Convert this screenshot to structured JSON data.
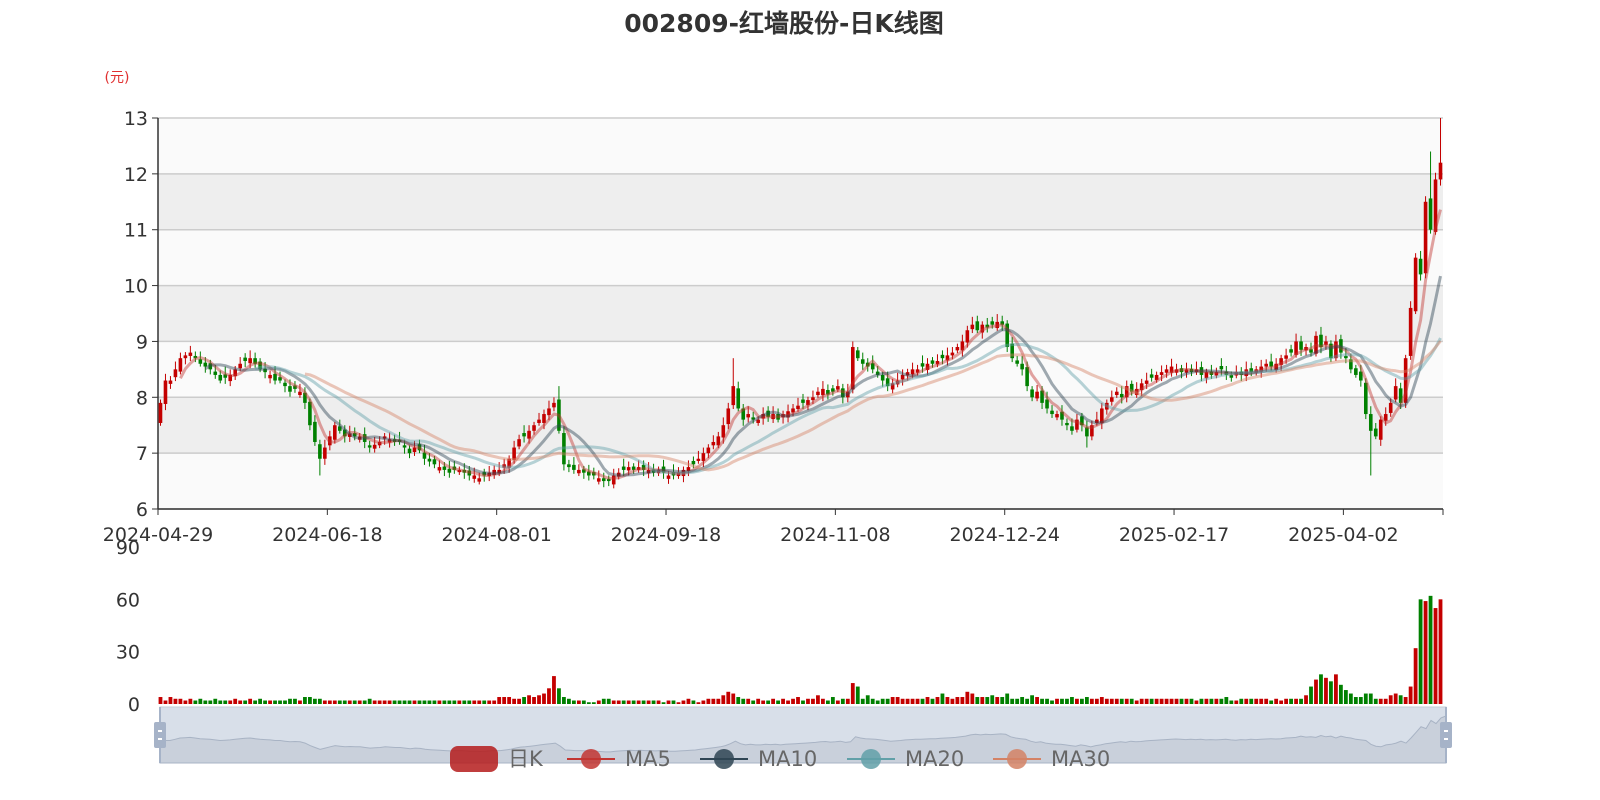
{
  "chart_data": {
    "type": "candlestick",
    "title": "002809-红墙股份-日K线图",
    "y_unit_label": "(元)",
    "ylim": [
      6,
      13
    ],
    "y_ticks": [
      6,
      7,
      8,
      9,
      10,
      11,
      12,
      13
    ],
    "volume_ylim": [
      0,
      90
    ],
    "volume_ticks": [
      0,
      30,
      60,
      90
    ],
    "x_tick_every": 34,
    "x_tick_labels": [
      "2024-04-29",
      "2024-06-18",
      "2024-08-01",
      "2024-09-18",
      "2024-11-08",
      "2024-12-24",
      "2025-02-17",
      "2025-04-02"
    ],
    "legend": [
      "日K",
      "MA5",
      "MA10",
      "MA20",
      "MA30"
    ],
    "legend_placement": "bottom-center",
    "colors": {
      "up": "#c40000",
      "down": "#008000",
      "MA5": "#c23531",
      "MA10": "#2f4554",
      "MA20": "#61a0a8",
      "MA30": "#d48265"
    },
    "close": [
      7.9,
      8.3,
      8.3,
      8.5,
      8.7,
      8.75,
      8.8,
      8.7,
      8.6,
      8.55,
      8.5,
      8.4,
      8.3,
      8.35,
      8.4,
      8.5,
      8.6,
      8.65,
      8.7,
      8.6,
      8.5,
      8.45,
      8.4,
      8.3,
      8.3,
      8.2,
      8.1,
      8.15,
      8.1,
      7.9,
      7.5,
      7.2,
      6.9,
      7.1,
      7.3,
      7.5,
      7.4,
      7.3,
      7.35,
      7.3,
      7.3,
      7.2,
      7.1,
      7.15,
      7.2,
      7.3,
      7.25,
      7.2,
      7.2,
      7.1,
      7.0,
      7.1,
      7.05,
      6.9,
      6.85,
      6.8,
      6.75,
      6.7,
      6.65,
      6.7,
      6.7,
      6.65,
      6.6,
      6.6,
      6.55,
      6.6,
      6.65,
      6.7,
      6.7,
      6.8,
      6.9,
      7.1,
      7.25,
      7.3,
      7.4,
      7.5,
      7.6,
      7.7,
      7.8,
      7.9,
      7.4,
      6.8,
      6.75,
      6.7,
      6.7,
      6.65,
      6.6,
      6.6,
      6.55,
      6.5,
      6.5,
      6.6,
      6.65,
      6.7,
      6.75,
      6.7,
      6.75,
      6.7,
      6.7,
      6.65,
      6.7,
      6.65,
      6.6,
      6.6,
      6.65,
      6.7,
      6.75,
      6.8,
      6.9,
      7.0,
      7.1,
      7.2,
      7.3,
      7.5,
      7.8,
      8.2,
      7.8,
      7.6,
      7.7,
      7.6,
      7.6,
      7.7,
      7.65,
      7.7,
      7.6,
      7.7,
      7.75,
      7.8,
      7.85,
      7.9,
      7.95,
      8.0,
      8.1,
      8.15,
      8.05,
      8.1,
      8.2,
      8.0,
      8.1,
      8.9,
      8.7,
      8.6,
      8.55,
      8.5,
      8.4,
      8.3,
      8.2,
      8.25,
      8.3,
      8.4,
      8.45,
      8.5,
      8.5,
      8.55,
      8.6,
      8.6,
      8.65,
      8.7,
      8.75,
      8.8,
      8.9,
      9.0,
      9.2,
      9.3,
      9.2,
      9.3,
      9.25,
      9.3,
      9.35,
      9.3,
      8.9,
      8.7,
      8.6,
      8.5,
      8.2,
      8.0,
      8.1,
      7.9,
      7.8,
      7.7,
      7.7,
      7.6,
      7.5,
      7.4,
      7.6,
      7.5,
      7.3,
      7.5,
      7.6,
      7.8,
      7.9,
      8.0,
      8.1,
      8.0,
      8.2,
      8.1,
      8.15,
      8.25,
      8.3,
      8.35,
      8.4,
      8.45,
      8.5,
      8.55,
      8.5,
      8.45,
      8.5,
      8.45,
      8.5,
      8.4,
      8.45,
      8.4,
      8.45,
      8.5,
      8.4,
      8.35,
      8.45,
      8.4,
      8.5,
      8.45,
      8.5,
      8.55,
      8.6,
      8.55,
      8.6,
      8.7,
      8.75,
      8.8,
      9.0,
      8.85,
      8.9,
      8.8,
      9.1,
      8.9,
      9.0,
      8.7,
      9.0,
      8.8,
      8.7,
      8.5,
      8.4,
      8.3,
      7.7,
      7.4,
      7.3,
      7.6,
      7.7,
      7.9,
      8.2,
      7.9,
      8.7,
      9.6,
      10.5,
      10.2,
      11.5,
      11.0,
      11.9,
      12.2
    ],
    "extremes": {
      "32": {
        "low": 6.6
      },
      "80": {
        "high": 8.2
      },
      "115": {
        "high": 8.7
      },
      "139": {
        "high": 9.0
      },
      "186": {
        "low": 7.1
      },
      "243": {
        "low": 6.6
      },
      "255": {
        "high": 12.4
      },
      "257": {
        "high": 13.0
      }
    },
    "volume": [
      4,
      2,
      4,
      3,
      3,
      2,
      3,
      2,
      3,
      2,
      2,
      3,
      2,
      2,
      2,
      3,
      2,
      2,
      3,
      2,
      3,
      2,
      2,
      2,
      2,
      2,
      3,
      3,
      2,
      4,
      4,
      3,
      3,
      2,
      2,
      2,
      2,
      2,
      2,
      2,
      2,
      2,
      3,
      2,
      2,
      2,
      2,
      2,
      2,
      2,
      2,
      2,
      2,
      2,
      2,
      2,
      2,
      2,
      2,
      2,
      2,
      2,
      2,
      2,
      2,
      2,
      2,
      2,
      4,
      4,
      4,
      3,
      3,
      4,
      5,
      4,
      5,
      6,
      9,
      16,
      9,
      4,
      3,
      2,
      2,
      2,
      1,
      1,
      2,
      3,
      3,
      2,
      2,
      2,
      2,
      2,
      2,
      2,
      2,
      2,
      2,
      1,
      2,
      2,
      1,
      2,
      3,
      2,
      1,
      2,
      3,
      3,
      3,
      5,
      7,
      6,
      4,
      3,
      3,
      2,
      3,
      2,
      2,
      3,
      2,
      3,
      2,
      3,
      4,
      2,
      3,
      3,
      5,
      3,
      2,
      4,
      2,
      3,
      3,
      12,
      10,
      3,
      5,
      3,
      2,
      3,
      3,
      4,
      4,
      3,
      3,
      3,
      3,
      3,
      4,
      3,
      4,
      6,
      4,
      3,
      4,
      4,
      7,
      6,
      4,
      4,
      4,
      5,
      4,
      4,
      6,
      3,
      3,
      4,
      3,
      5,
      4,
      3,
      3,
      2,
      3,
      3,
      3,
      4,
      3,
      3,
      4,
      3,
      3,
      4,
      3,
      3,
      3,
      3,
      3,
      3,
      2,
      3,
      3,
      3,
      3,
      3,
      3,
      3,
      3,
      3,
      3,
      3,
      2,
      3,
      3,
      3,
      3,
      3,
      4,
      2,
      2,
      3,
      3,
      3,
      3,
      3,
      3,
      2,
      3,
      2,
      3,
      3,
      3,
      3,
      5,
      10,
      14,
      17,
      15,
      13,
      17,
      11,
      8,
      6,
      4,
      4,
      6,
      6,
      3,
      3,
      3,
      5,
      6,
      5,
      4,
      10,
      32,
      60,
      59,
      62,
      55,
      60
    ]
  }
}
